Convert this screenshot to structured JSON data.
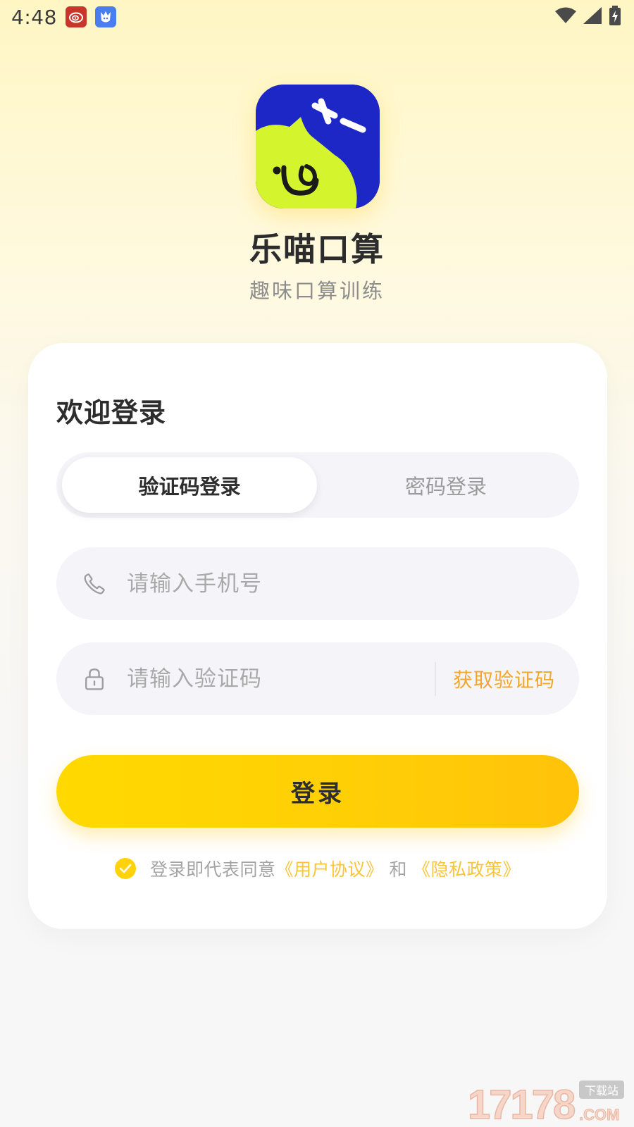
{
  "status_bar": {
    "time": "4:48",
    "icons": [
      "weibo-icon",
      "app-notification-icon",
      "wifi-icon",
      "cellular-signal-icon",
      "battery-charging-icon"
    ]
  },
  "app": {
    "name": "乐喵口算",
    "tagline": "趣味口算训练",
    "logo_colors": {
      "background": "#1d27c6",
      "cat": "#d4f52d"
    }
  },
  "card": {
    "welcome": "欢迎登录",
    "tabs": [
      {
        "label": "验证码登录",
        "active": true
      },
      {
        "label": "密码登录",
        "active": false
      }
    ],
    "phone_field": {
      "placeholder": "请输入手机号",
      "value": ""
    },
    "code_field": {
      "placeholder": "请输入验证码",
      "value": ""
    },
    "get_code_label": "获取验证码",
    "login_button_label": "登录",
    "agreement": {
      "checked": true,
      "prefix": "登录即代表同意",
      "user_agreement": "《用户协议》",
      "and": "和",
      "privacy_policy": "《隐私政策》"
    }
  },
  "colors": {
    "accent": "#ffd200",
    "link": "#f8c43a",
    "get_code": "#f4a62a"
  },
  "watermark": {
    "text": "17178",
    "suffix": ".COM",
    "badge": "下载站"
  }
}
